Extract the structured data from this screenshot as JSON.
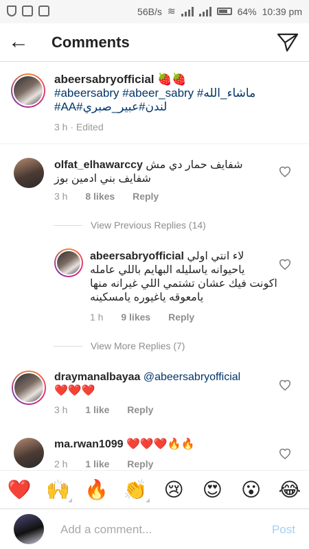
{
  "status": {
    "left_icons": [
      "shield-icon",
      "square-icon",
      "activity-icon"
    ],
    "speed": "56B/s",
    "battery": "64%",
    "time": "10:39 pm"
  },
  "header": {
    "back_icon": "arrow-left-icon",
    "title": "Comments",
    "send_icon": "paper-plane-icon"
  },
  "caption": {
    "username": "abeersabryofficial",
    "emojis": "🍓🍓",
    "hashtags_line1": "#abeersabry #abeer_sabry #ماشاء_الله",
    "hashtags_line2": "#AA#لندن#عبير_صبري",
    "time": "3 h",
    "edited": "Edited"
  },
  "comments": [
    {
      "username": "olfat_elhawarccy",
      "text_line1": "شفايف حمار دي مش",
      "text_line2": "شفايف بني ادمين بوز",
      "time": "3 h",
      "likes": "8 likes",
      "reply": "Reply"
    },
    {
      "username": "draymanalbayaa",
      "mention": "@abeersabryofficial",
      "hearts": "❤️❤️❤️",
      "time": "3 h",
      "likes": "1 like",
      "reply": "Reply"
    },
    {
      "username": "ma.rwan1099",
      "text": "❤️❤️❤️🔥🔥",
      "time": "2 h",
      "likes": "1 like",
      "reply": "Reply"
    }
  ],
  "replies": {
    "previous": "View Previous Replies (14)",
    "more": "View More Replies (7)",
    "reply": {
      "username": "abeersabryofficial",
      "line1": "لاء انتي اولي",
      "line2": "ياحيوانه ياسليله البهايم باللي عامله",
      "line3": "اكونت فيك عشان تشتمي اللي غيرانه منها",
      "line4": "يامعوقه ياغيوره يامسكينه",
      "time": "1 h",
      "likes": "9 likes",
      "reply": "Reply"
    }
  },
  "emoji_bar": [
    "❤️",
    "🙌",
    "🔥",
    "👏",
    "😢",
    "😍",
    "😮",
    "😂"
  ],
  "composer": {
    "placeholder": "Add a comment...",
    "post": "Post"
  },
  "colors": {
    "accent": "#003569",
    "post_disabled": "#9fd0f5",
    "muted": "#999999"
  }
}
